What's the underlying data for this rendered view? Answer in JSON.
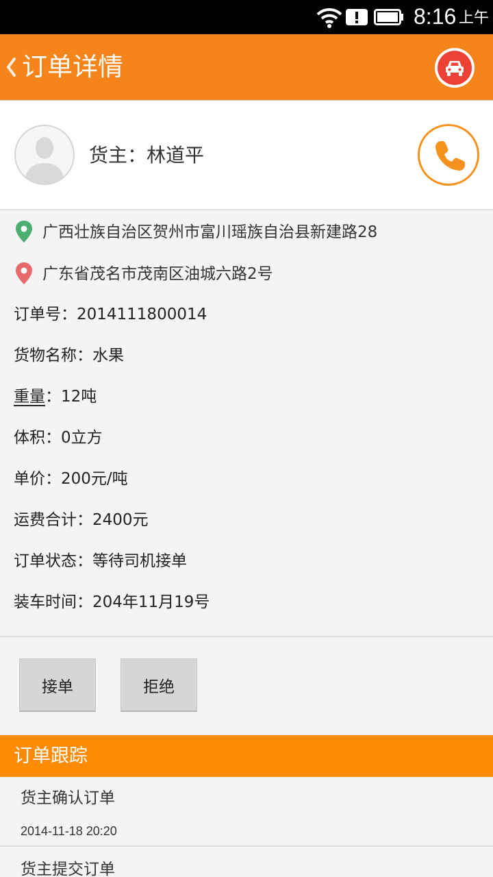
{
  "status_bar": {
    "time": "8:16",
    "ampm": "上午",
    "icons": [
      "wifi-icon",
      "alert-icon",
      "battery-icon"
    ]
  },
  "header": {
    "title": "订单详情",
    "back_icon": "chevron-left-icon",
    "action_icon": "car-icon",
    "accent_color": "#f5841a",
    "action_color": "#ee4136"
  },
  "owner": {
    "label": "货主：林道平",
    "avatar_icon": "person-avatar-icon",
    "call_icon": "phone-icon"
  },
  "addresses": {
    "from": "广西壮族自治区贺州市富川瑶族自治县新建路28",
    "to": "广东省茂名市茂南区油城六路2号",
    "from_color": "#4caf72",
    "to_color": "#e8686b"
  },
  "order": {
    "order_no": "订单号：2014111800014",
    "goods_name": "货物名称：水果",
    "weight_key": "重量",
    "weight_val": "：12吨",
    "volume": "体积：0立方",
    "unit_price": "单价：200元/吨",
    "total_fee": "运费合计：2400元",
    "status": "订单状态：等待司机接单",
    "load_time": "装车时间：204年11月19号"
  },
  "actions": {
    "accept_label": "接单",
    "reject_label": "拒绝"
  },
  "tracking": {
    "header": "订单跟踪",
    "header_color": "#fd8b03",
    "items": [
      {
        "title": "货主确认订单",
        "date": "2014-11-18 20:20"
      },
      {
        "title": "货主提交订单",
        "date": ""
      }
    ]
  }
}
